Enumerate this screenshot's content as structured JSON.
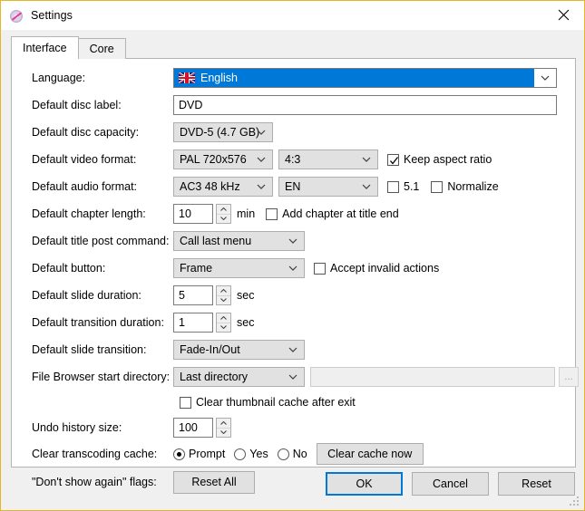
{
  "window": {
    "title": "Settings",
    "icon": "disc-icon",
    "close_icon": "close-icon",
    "border_color": "#e8b528"
  },
  "tabs": [
    {
      "label": "Interface",
      "active": true
    },
    {
      "label": "Core",
      "active": false
    }
  ],
  "fields": {
    "language": {
      "label": "Language:",
      "value": "English",
      "flag": "uk-flag-icon",
      "highlighted": true
    },
    "disc_label": {
      "label": "Default disc label:",
      "value": "DVD"
    },
    "disc_capacity": {
      "label": "Default disc capacity:",
      "value": "DVD-5 (4.7 GB)"
    },
    "video_format": {
      "label": "Default video format:",
      "value": "PAL 720x576",
      "aspect_value": "4:3",
      "keep_aspect_ratio": {
        "label": "Keep aspect ratio",
        "checked": true
      }
    },
    "audio_format": {
      "label": "Default audio format:",
      "value": "AC3 48 kHz",
      "language_value": "EN",
      "surround": {
        "label": "5.1",
        "checked": false
      },
      "normalize": {
        "label": "Normalize",
        "checked": false
      }
    },
    "chapter_length": {
      "label": "Default chapter length:",
      "value": "10",
      "unit": "min",
      "add_chapter": {
        "label": "Add chapter at title end",
        "checked": false
      }
    },
    "title_post_command": {
      "label": "Default title post command:",
      "value": "Call last menu"
    },
    "default_button": {
      "label": "Default button:",
      "value": "Frame",
      "accept_invalid": {
        "label": "Accept invalid actions",
        "checked": false
      }
    },
    "slide_duration": {
      "label": "Default slide duration:",
      "value": "5",
      "unit": "sec"
    },
    "transition_duration": {
      "label": "Default transition duration:",
      "value": "1",
      "unit": "sec"
    },
    "slide_transition": {
      "label": "Default slide transition:",
      "value": "Fade-In/Out"
    },
    "start_directory": {
      "label": "File Browser start directory:",
      "value": "Last directory",
      "path_value": "",
      "browse_label": "...",
      "clear_thumbnail": {
        "label": "Clear thumbnail cache after exit",
        "checked": false
      }
    },
    "undo_history": {
      "label": "Undo history size:",
      "value": "100"
    },
    "clear_transcoding": {
      "label": "Clear transcoding cache:",
      "options": [
        {
          "label": "Prompt",
          "selected": true
        },
        {
          "label": "Yes",
          "selected": false
        },
        {
          "label": "No",
          "selected": false
        }
      ],
      "button_label": "Clear cache now"
    },
    "dont_show_again": {
      "label": "\"Don't show again\" flags:",
      "button_label": "Reset All"
    }
  },
  "footer": {
    "ok": "OK",
    "cancel": "Cancel",
    "reset": "Reset"
  }
}
